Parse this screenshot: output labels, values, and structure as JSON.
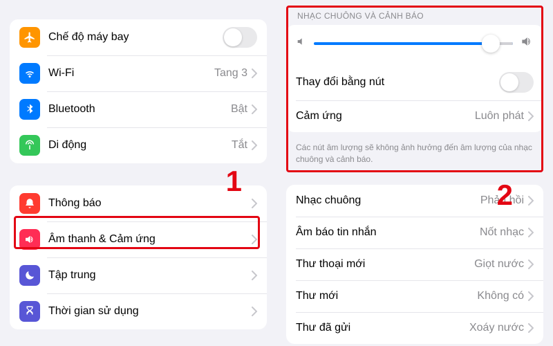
{
  "left": {
    "group1": {
      "airplane": "Chế độ máy bay",
      "wifi": {
        "label": "Wi-Fi",
        "value": "Tang 3"
      },
      "bluetooth": {
        "label": "Bluetooth",
        "value": "Bật"
      },
      "cellular": {
        "label": "Di động",
        "value": "Tắt"
      }
    },
    "group2": {
      "notifications": "Thông báo",
      "sounds": "Âm thanh & Cảm ứng",
      "focus": "Tập trung",
      "screentime": "Thời gian sử dụng"
    },
    "callout": "1"
  },
  "right": {
    "section_header": "NHẠC CHUÔNG VÀ CẢNH BÁO",
    "slider_value": 91,
    "change_with_buttons": "Thay đổi bằng nút",
    "haptics": {
      "label": "Cảm ứng",
      "value": "Luôn phát"
    },
    "footer": "Các nút âm lượng sẽ không ảnh hưởng đến âm lượng của nhạc chuông và cảnh báo.",
    "sounds": {
      "ringtone": {
        "label": "Nhạc chuông",
        "value": "Phản hồi"
      },
      "texttone": {
        "label": "Âm báo tin nhắn",
        "value": "Nốt nhạc"
      },
      "voicemail": {
        "label": "Thư thoại mới",
        "value": "Giọt nước"
      },
      "mail": {
        "label": "Thư mới",
        "value": "Không có"
      },
      "sent": {
        "label": "Thư đã gửi",
        "value": "Xoáy nước"
      }
    },
    "callout": "2"
  }
}
